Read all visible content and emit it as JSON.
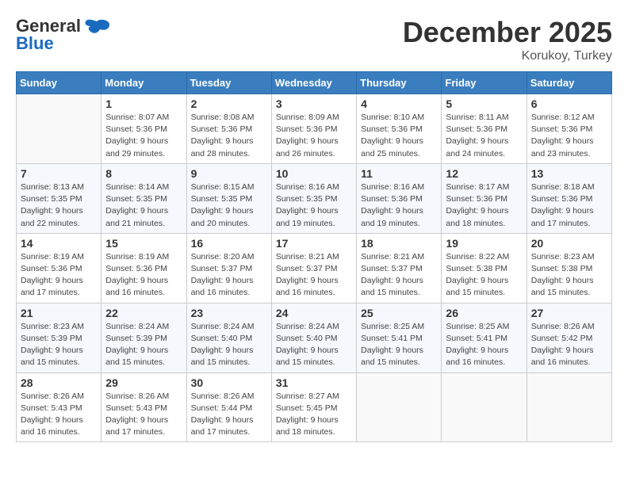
{
  "header": {
    "logo_line1": "General",
    "logo_line2": "Blue",
    "month": "December 2025",
    "location": "Korukoy, Turkey"
  },
  "weekdays": [
    "Sunday",
    "Monday",
    "Tuesday",
    "Wednesday",
    "Thursday",
    "Friday",
    "Saturday"
  ],
  "weeks": [
    [
      {
        "day": "",
        "info": ""
      },
      {
        "day": "1",
        "info": "Sunrise: 8:07 AM\nSunset: 5:36 PM\nDaylight: 9 hours\nand 29 minutes."
      },
      {
        "day": "2",
        "info": "Sunrise: 8:08 AM\nSunset: 5:36 PM\nDaylight: 9 hours\nand 28 minutes."
      },
      {
        "day": "3",
        "info": "Sunrise: 8:09 AM\nSunset: 5:36 PM\nDaylight: 9 hours\nand 26 minutes."
      },
      {
        "day": "4",
        "info": "Sunrise: 8:10 AM\nSunset: 5:36 PM\nDaylight: 9 hours\nand 25 minutes."
      },
      {
        "day": "5",
        "info": "Sunrise: 8:11 AM\nSunset: 5:36 PM\nDaylight: 9 hours\nand 24 minutes."
      },
      {
        "day": "6",
        "info": "Sunrise: 8:12 AM\nSunset: 5:36 PM\nDaylight: 9 hours\nand 23 minutes."
      }
    ],
    [
      {
        "day": "7",
        "info": "Sunrise: 8:13 AM\nSunset: 5:35 PM\nDaylight: 9 hours\nand 22 minutes."
      },
      {
        "day": "8",
        "info": "Sunrise: 8:14 AM\nSunset: 5:35 PM\nDaylight: 9 hours\nand 21 minutes."
      },
      {
        "day": "9",
        "info": "Sunrise: 8:15 AM\nSunset: 5:35 PM\nDaylight: 9 hours\nand 20 minutes."
      },
      {
        "day": "10",
        "info": "Sunrise: 8:16 AM\nSunset: 5:35 PM\nDaylight: 9 hours\nand 19 minutes."
      },
      {
        "day": "11",
        "info": "Sunrise: 8:16 AM\nSunset: 5:36 PM\nDaylight: 9 hours\nand 19 minutes."
      },
      {
        "day": "12",
        "info": "Sunrise: 8:17 AM\nSunset: 5:36 PM\nDaylight: 9 hours\nand 18 minutes."
      },
      {
        "day": "13",
        "info": "Sunrise: 8:18 AM\nSunset: 5:36 PM\nDaylight: 9 hours\nand 17 minutes."
      }
    ],
    [
      {
        "day": "14",
        "info": "Sunrise: 8:19 AM\nSunset: 5:36 PM\nDaylight: 9 hours\nand 17 minutes."
      },
      {
        "day": "15",
        "info": "Sunrise: 8:19 AM\nSunset: 5:36 PM\nDaylight: 9 hours\nand 16 minutes."
      },
      {
        "day": "16",
        "info": "Sunrise: 8:20 AM\nSunset: 5:37 PM\nDaylight: 9 hours\nand 16 minutes."
      },
      {
        "day": "17",
        "info": "Sunrise: 8:21 AM\nSunset: 5:37 PM\nDaylight: 9 hours\nand 16 minutes."
      },
      {
        "day": "18",
        "info": "Sunrise: 8:21 AM\nSunset: 5:37 PM\nDaylight: 9 hours\nand 15 minutes."
      },
      {
        "day": "19",
        "info": "Sunrise: 8:22 AM\nSunset: 5:38 PM\nDaylight: 9 hours\nand 15 minutes."
      },
      {
        "day": "20",
        "info": "Sunrise: 8:23 AM\nSunset: 5:38 PM\nDaylight: 9 hours\nand 15 minutes."
      }
    ],
    [
      {
        "day": "21",
        "info": "Sunrise: 8:23 AM\nSunset: 5:39 PM\nDaylight: 9 hours\nand 15 minutes."
      },
      {
        "day": "22",
        "info": "Sunrise: 8:24 AM\nSunset: 5:39 PM\nDaylight: 9 hours\nand 15 minutes."
      },
      {
        "day": "23",
        "info": "Sunrise: 8:24 AM\nSunset: 5:40 PM\nDaylight: 9 hours\nand 15 minutes."
      },
      {
        "day": "24",
        "info": "Sunrise: 8:24 AM\nSunset: 5:40 PM\nDaylight: 9 hours\nand 15 minutes."
      },
      {
        "day": "25",
        "info": "Sunrise: 8:25 AM\nSunset: 5:41 PM\nDaylight: 9 hours\nand 15 minutes."
      },
      {
        "day": "26",
        "info": "Sunrise: 8:25 AM\nSunset: 5:41 PM\nDaylight: 9 hours\nand 16 minutes."
      },
      {
        "day": "27",
        "info": "Sunrise: 8:26 AM\nSunset: 5:42 PM\nDaylight: 9 hours\nand 16 minutes."
      }
    ],
    [
      {
        "day": "28",
        "info": "Sunrise: 8:26 AM\nSunset: 5:43 PM\nDaylight: 9 hours\nand 16 minutes."
      },
      {
        "day": "29",
        "info": "Sunrise: 8:26 AM\nSunset: 5:43 PM\nDaylight: 9 hours\nand 17 minutes."
      },
      {
        "day": "30",
        "info": "Sunrise: 8:26 AM\nSunset: 5:44 PM\nDaylight: 9 hours\nand 17 minutes."
      },
      {
        "day": "31",
        "info": "Sunrise: 8:27 AM\nSunset: 5:45 PM\nDaylight: 9 hours\nand 18 minutes."
      },
      {
        "day": "",
        "info": ""
      },
      {
        "day": "",
        "info": ""
      },
      {
        "day": "",
        "info": ""
      }
    ]
  ]
}
